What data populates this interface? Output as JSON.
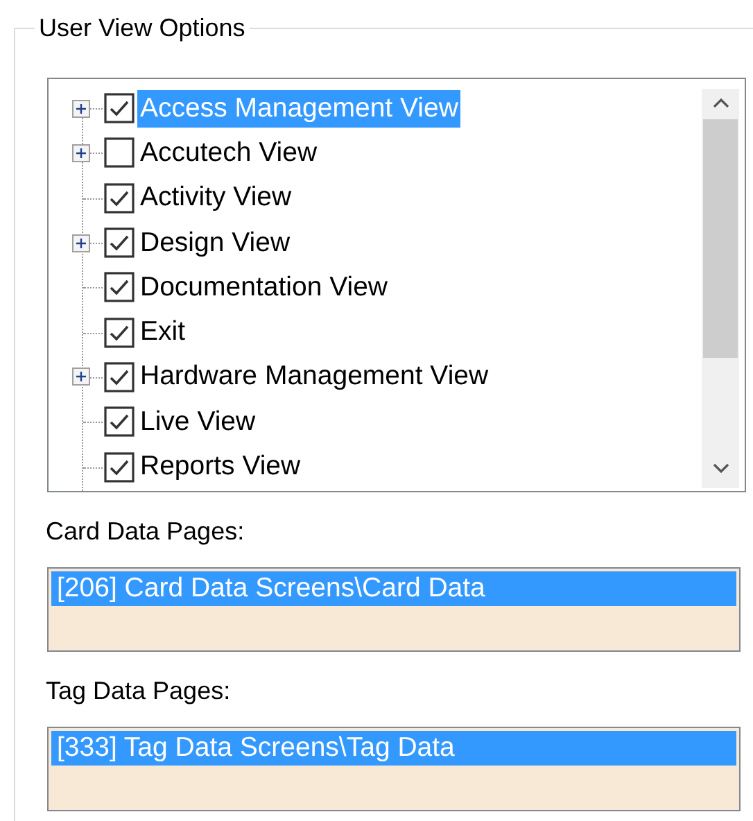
{
  "group": {
    "title": "User View Options"
  },
  "tree": {
    "items": [
      {
        "label": "Access Management View",
        "checked": true,
        "selected": true,
        "expandable": true
      },
      {
        "label": "Accutech View",
        "checked": false,
        "selected": false,
        "expandable": true
      },
      {
        "label": "Activity View",
        "checked": true,
        "selected": false,
        "expandable": false
      },
      {
        "label": "Design View",
        "checked": true,
        "selected": false,
        "expandable": true
      },
      {
        "label": "Documentation View",
        "checked": true,
        "selected": false,
        "expandable": false
      },
      {
        "label": "Exit",
        "checked": true,
        "selected": false,
        "expandable": false
      },
      {
        "label": "Hardware Management View",
        "checked": true,
        "selected": false,
        "expandable": true
      },
      {
        "label": "Live View",
        "checked": true,
        "selected": false,
        "expandable": false
      },
      {
        "label": "Reports View",
        "checked": true,
        "selected": false,
        "expandable": false
      }
    ]
  },
  "lists": [
    {
      "label": "Card Data Pages:",
      "items": [
        {
          "text": "[206] Card Data Screens\\Card Data",
          "selected": true
        }
      ]
    },
    {
      "label": "Tag Data Pages:",
      "items": [
        {
          "text": "[333] Tag Data Screens\\Tag Data",
          "selected": true
        }
      ]
    }
  ]
}
